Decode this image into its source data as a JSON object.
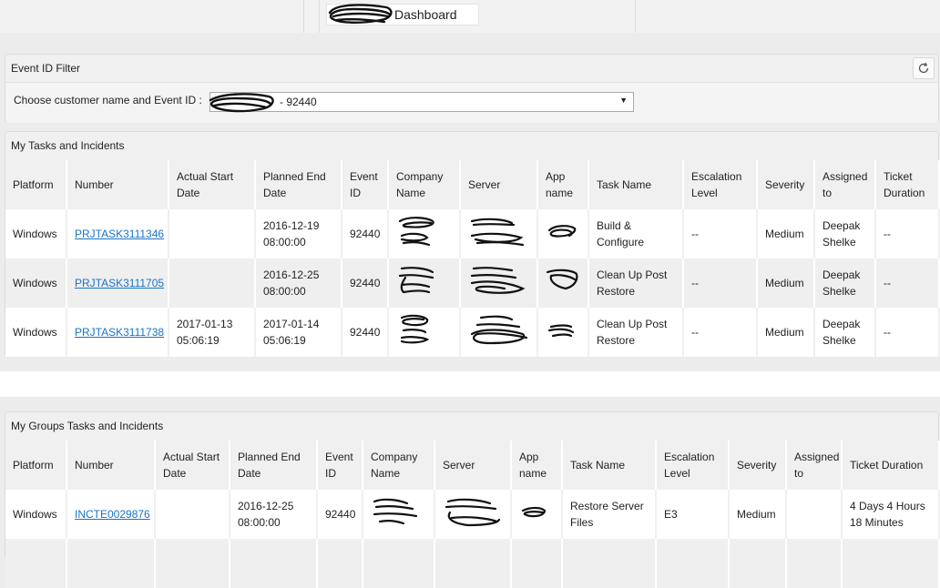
{
  "header": {
    "title": "Dashboard"
  },
  "event_filter": {
    "title": "Event ID Filter",
    "label": "Choose customer name and Event ID :",
    "selected_value": "- 92440",
    "refresh_icon": "refresh-icon"
  },
  "my_tasks": {
    "title": "My Tasks and Incidents",
    "columns": [
      "Platform",
      "Number",
      "Actual Start Date",
      "Planned End Date",
      "Event ID",
      "Company Name",
      "Server",
      "App name",
      "Task Name",
      "Escalation Level",
      "Severity",
      "Assigned to",
      "Ticket Duration"
    ],
    "rows": [
      {
        "platform": "Windows",
        "number": "PRJTASK3111346",
        "actual_start": "",
        "planned_end": "2016-12-19 08:00:00",
        "event_id": "92440",
        "task_name": "Build & Configure",
        "escalation": "--",
        "severity": "Medium",
        "assigned": "Deepak Shelke",
        "duration": "--"
      },
      {
        "platform": "Windows",
        "number": "PRJTASK3111705",
        "actual_start": "",
        "planned_end": "2016-12-25 08:00:00",
        "event_id": "92440",
        "task_name": "Clean Up Post Restore",
        "escalation": "--",
        "severity": "Medium",
        "assigned": "Deepak Shelke",
        "duration": "--"
      },
      {
        "platform": "Windows",
        "number": "PRJTASK3111738",
        "actual_start": "2017-01-13 05:06:19",
        "planned_end": "2017-01-14 05:06:19",
        "event_id": "92440",
        "task_name": "Clean Up Post Restore",
        "escalation": "--",
        "severity": "Medium",
        "assigned": "Deepak Shelke",
        "duration": "--"
      }
    ]
  },
  "group_tasks": {
    "title": "My Groups Tasks and Incidents",
    "columns": [
      "Platform",
      "Number",
      "Actual Start Date",
      "Planned End Date",
      "Event ID",
      "Company Name",
      "Server",
      "App name",
      "Task Name",
      "Escalation Level",
      "Severity",
      "Assigned to",
      "Ticket Duration"
    ],
    "rows": [
      {
        "platform": "Windows",
        "number": "INCTE0029876",
        "actual_start": "",
        "planned_end": "2016-12-25 08:00:00",
        "event_id": "92440",
        "task_name": "Restore Server Files",
        "escalation": "E3",
        "severity": "Medium",
        "assigned": "",
        "duration": "4 Days 4 Hours 18 Minutes"
      }
    ]
  },
  "colors": {
    "link": "#1a73c5",
    "header_bg": "#f0f0f0",
    "alt_row_bg": "#efefef"
  }
}
